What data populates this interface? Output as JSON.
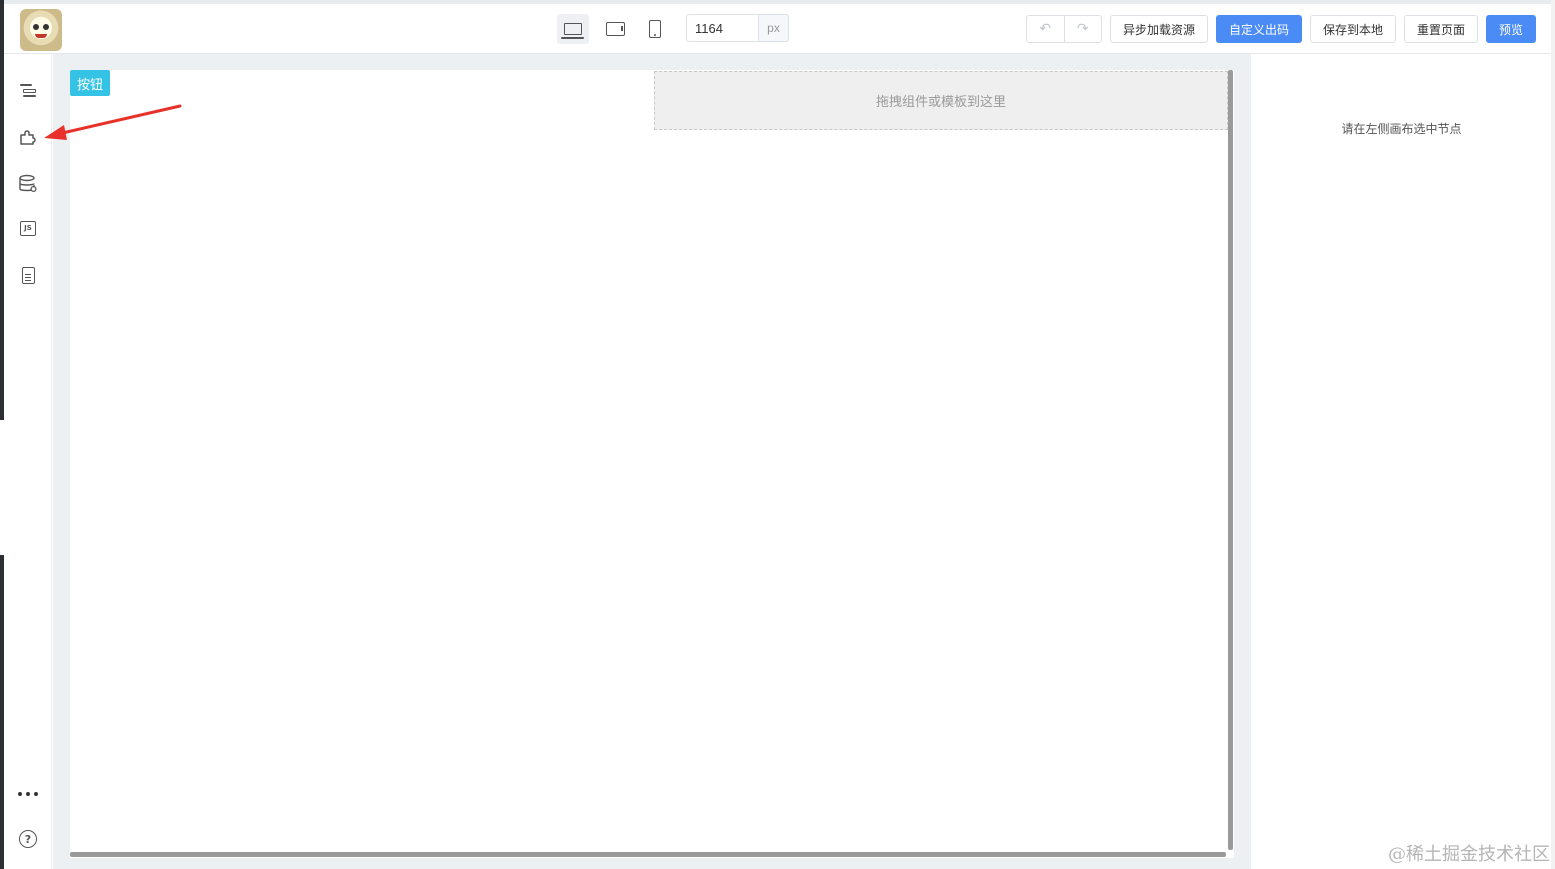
{
  "header": {
    "logo_icon": "avatar-logo-icon",
    "devices": [
      {
        "name": "desktop",
        "icon": "laptop-icon",
        "active": true
      },
      {
        "name": "tablet",
        "icon": "tablet-icon",
        "active": false
      },
      {
        "name": "phone",
        "icon": "phone-icon",
        "active": false
      }
    ],
    "canvas_width_value": "1164",
    "canvas_width_unit": "px",
    "undo_icon": "undo-icon",
    "redo_icon": "redo-icon",
    "async_load_label": "异步加载资源",
    "custom_code_label": "自定义出码",
    "save_local_label": "保存到本地",
    "reset_page_label": "重置页面",
    "preview_label": "预览",
    "primary_color": "#4a8bf5"
  },
  "sidebar": {
    "items": [
      {
        "icon": "outline-tree-icon"
      },
      {
        "icon": "component-puzzle-icon"
      },
      {
        "icon": "datasource-icon"
      },
      {
        "icon": "js-code-icon"
      },
      {
        "icon": "page-schema-icon"
      }
    ],
    "more_icon": "more-dots-icon",
    "help_icon": "help-circle-icon"
  },
  "canvas": {
    "button_label": "按钮",
    "button_color": "#34c3e5",
    "dropzone_text": "拖拽组件或模板到这里"
  },
  "settings": {
    "empty_text": "请在左侧画布选中节点"
  },
  "annotation": {
    "arrow_color": "#e8312b"
  },
  "watermark": "@稀土掘金技术社区"
}
